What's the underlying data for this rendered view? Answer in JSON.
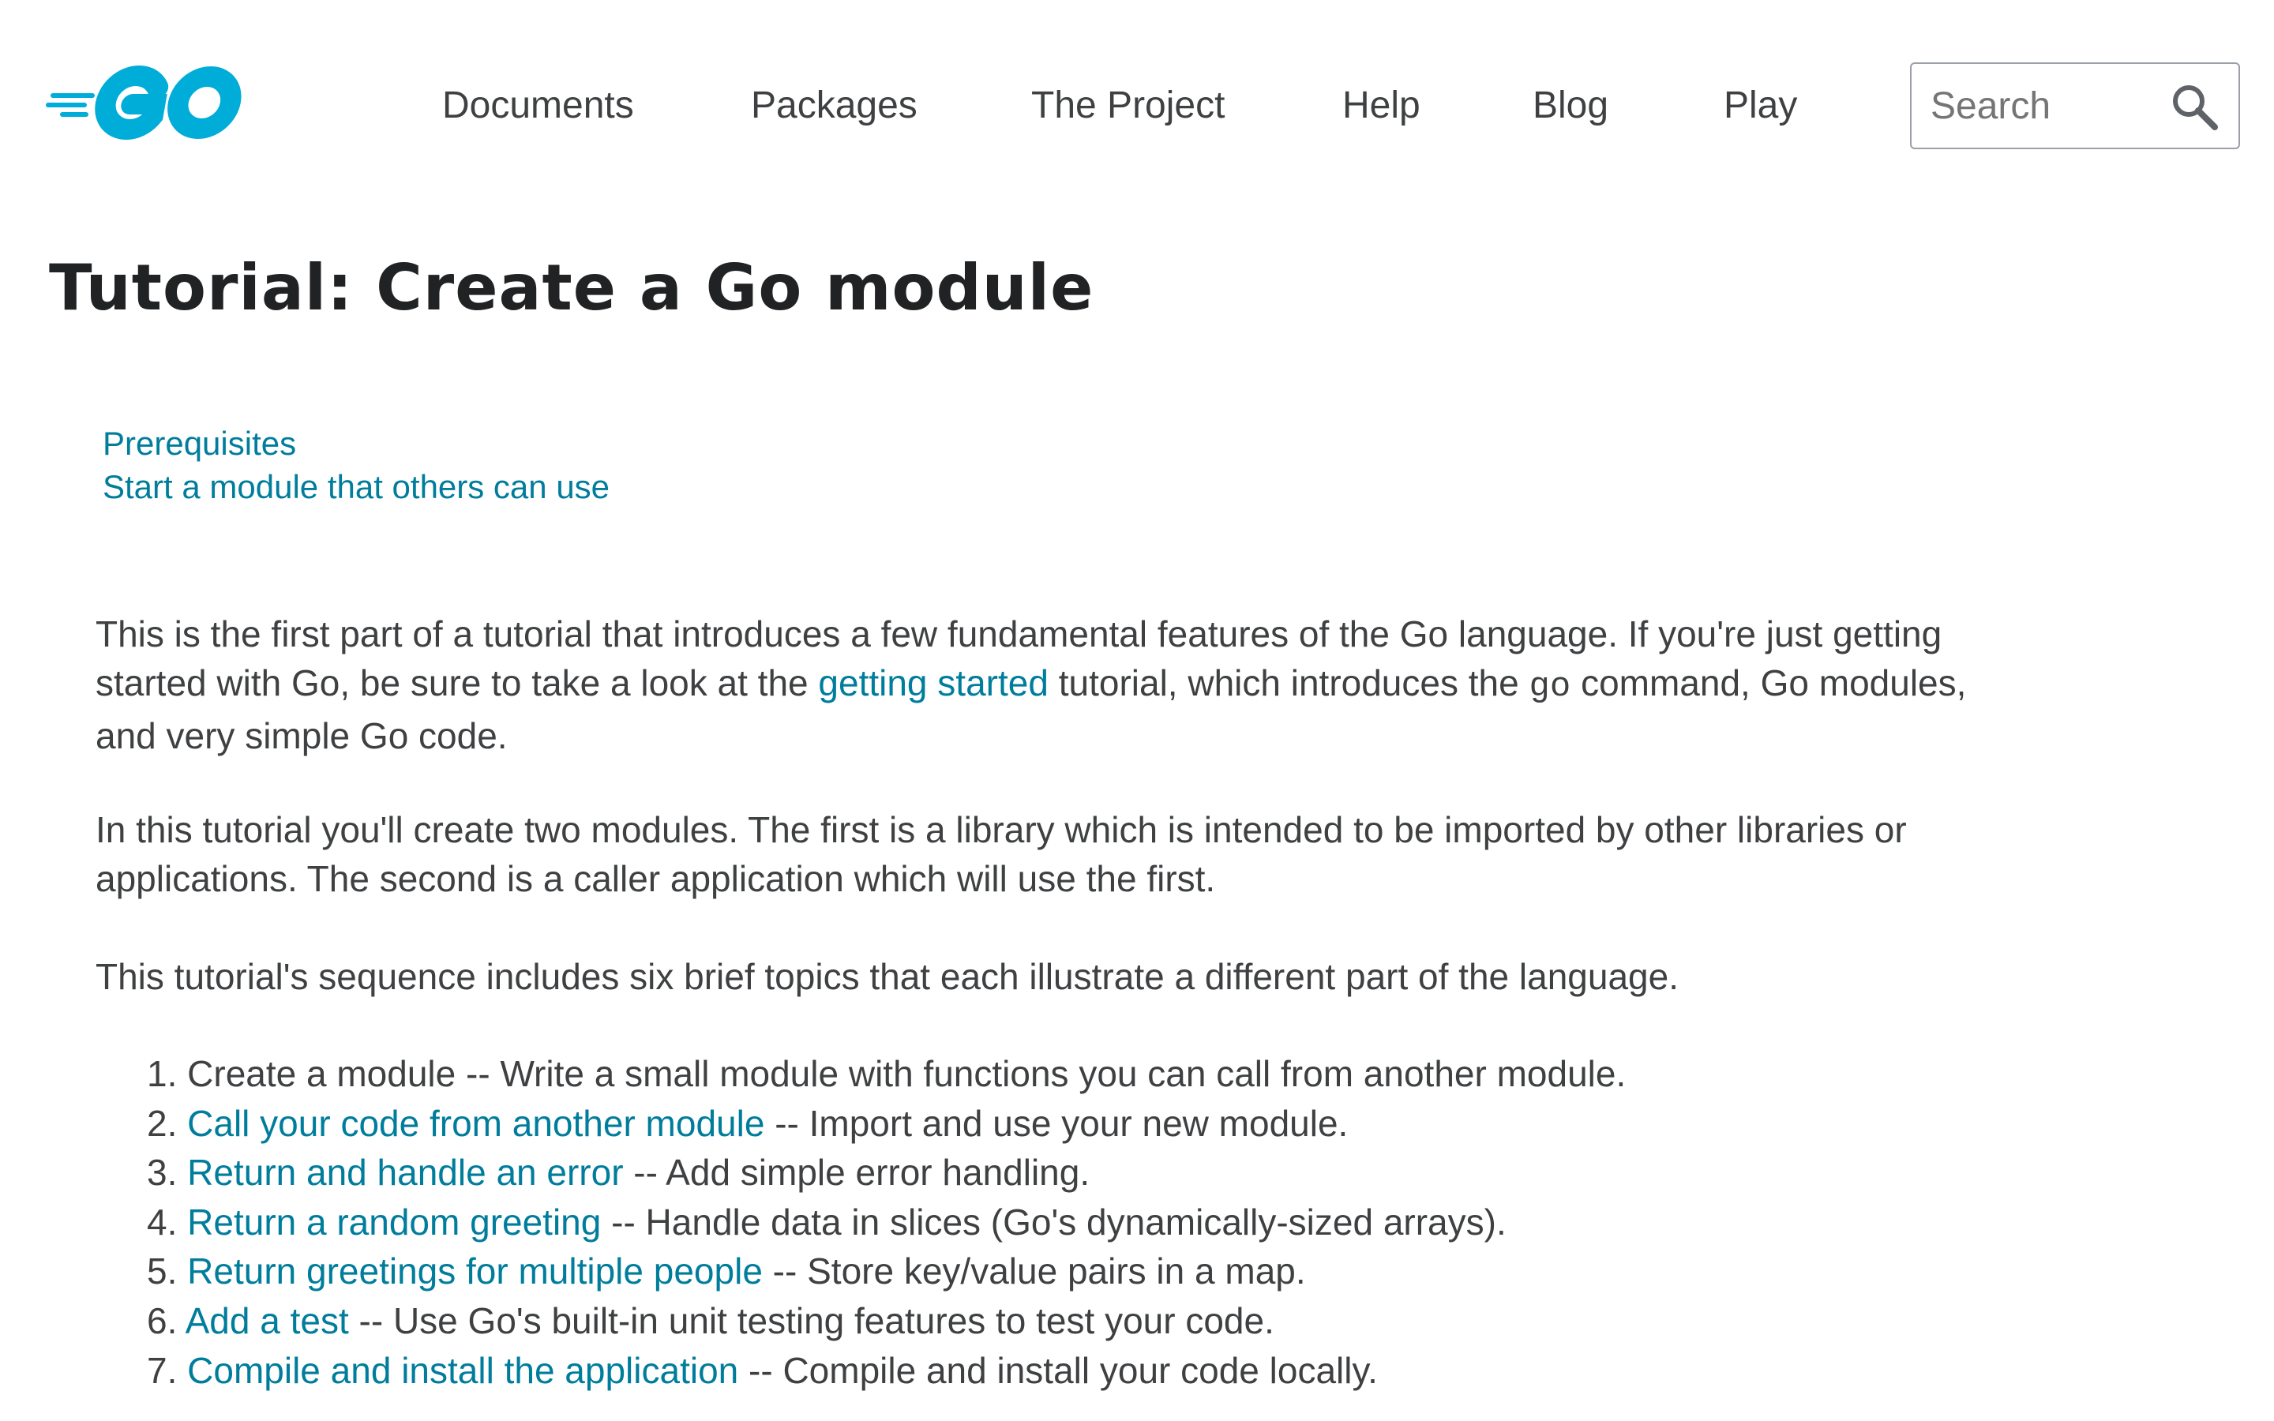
{
  "header": {
    "logo_text": "GO",
    "nav": [
      {
        "label": "Documents"
      },
      {
        "label": "Packages"
      },
      {
        "label": "The Project"
      },
      {
        "label": "Help"
      },
      {
        "label": "Blog"
      },
      {
        "label": "Play"
      }
    ],
    "search": {
      "placeholder": "Search",
      "value": "",
      "icon": "search-icon"
    }
  },
  "main": {
    "title": "Tutorial: Create a Go module",
    "toc": [
      {
        "label": "Prerequisites"
      },
      {
        "label": "Start a module that others can use"
      }
    ],
    "intro": {
      "before_link": "This is the first part of a tutorial that introduces a few fundamental features of the Go language. If you're just getting started with Go, be sure to take a look at the ",
      "link": "getting started",
      "middle": " tutorial, which introduces the ",
      "code": "go",
      "after_code": " command, Go modules, and very simple Go code."
    },
    "paragraph2": "In this tutorial you'll create two modules. The first is a library which is intended to be imported by other libraries or applications. The second is a caller application which will use the first.",
    "paragraph3": "This tutorial's sequence includes six brief topics that each illustrate a different part of the language.",
    "steps": [
      {
        "number": "1.",
        "title": "Create a module",
        "is_link": false,
        "desc": " -- Write a small module with functions you can call from another module."
      },
      {
        "number": "2.",
        "title": "Call your code from another module",
        "is_link": true,
        "desc": " -- Import and use your new module."
      },
      {
        "number": "3.",
        "title": "Return and handle an error",
        "is_link": true,
        "desc": " -- Add simple error handling."
      },
      {
        "number": "4.",
        "title": "Return a random greeting",
        "is_link": true,
        "desc": " -- Handle data in slices (Go's dynamically-sized arrays)."
      },
      {
        "number": "5.",
        "title": "Return greetings for multiple people",
        "is_link": true,
        "desc": " -- Store key/value pairs in a map."
      },
      {
        "number": "6.",
        "title": "Add a test",
        "is_link": true,
        "desc": " -- Use Go's built-in unit testing features to test your code."
      },
      {
        "number": "7.",
        "title": "Compile and install the application",
        "is_link": true,
        "desc": " -- Compile and install your code locally."
      }
    ]
  },
  "colors": {
    "brand": "#00add8",
    "link": "#007d9c",
    "text": "#3e4042",
    "heading": "#202224"
  }
}
